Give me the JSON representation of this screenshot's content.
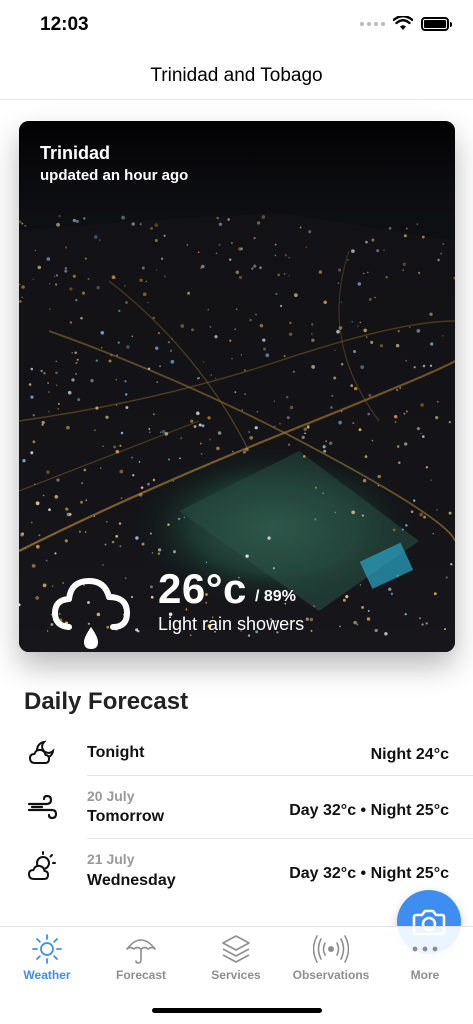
{
  "status_bar": {
    "time": "12:03"
  },
  "header": {
    "title": "Trinidad and Tobago"
  },
  "hero": {
    "location": "Trinidad",
    "updated": "updated an hour ago",
    "temperature": "26°c",
    "humidity": "/ 89%",
    "condition": "Light rain showers",
    "icon": "cloud-rain-icon"
  },
  "daily_forecast": {
    "title": "Daily Forecast",
    "rows": [
      {
        "date": "",
        "day": "Tonight",
        "temps": "Night 24°c",
        "icon": "cloudy-night-icon"
      },
      {
        "date": "20 July",
        "day": "Tomorrow",
        "temps": "Day 32°c • Night 25°c",
        "icon": "wind-icon"
      },
      {
        "date": "21 July",
        "day": "Wednesday",
        "temps": "Day 32°c • Night 25°c",
        "icon": "partly-cloudy-icon"
      }
    ]
  },
  "tabs": [
    {
      "label": "Weather",
      "icon": "sun-icon",
      "active": true
    },
    {
      "label": "Forecast",
      "icon": "umbrella-icon",
      "active": false
    },
    {
      "label": "Services",
      "icon": "layers-icon",
      "active": false
    },
    {
      "label": "Observations",
      "icon": "broadcast-icon",
      "active": false
    },
    {
      "label": "More",
      "icon": "more-dots-icon",
      "active": false
    }
  ],
  "colors": {
    "accent": "#3d8ef0",
    "inactive": "#8e8e8e"
  }
}
